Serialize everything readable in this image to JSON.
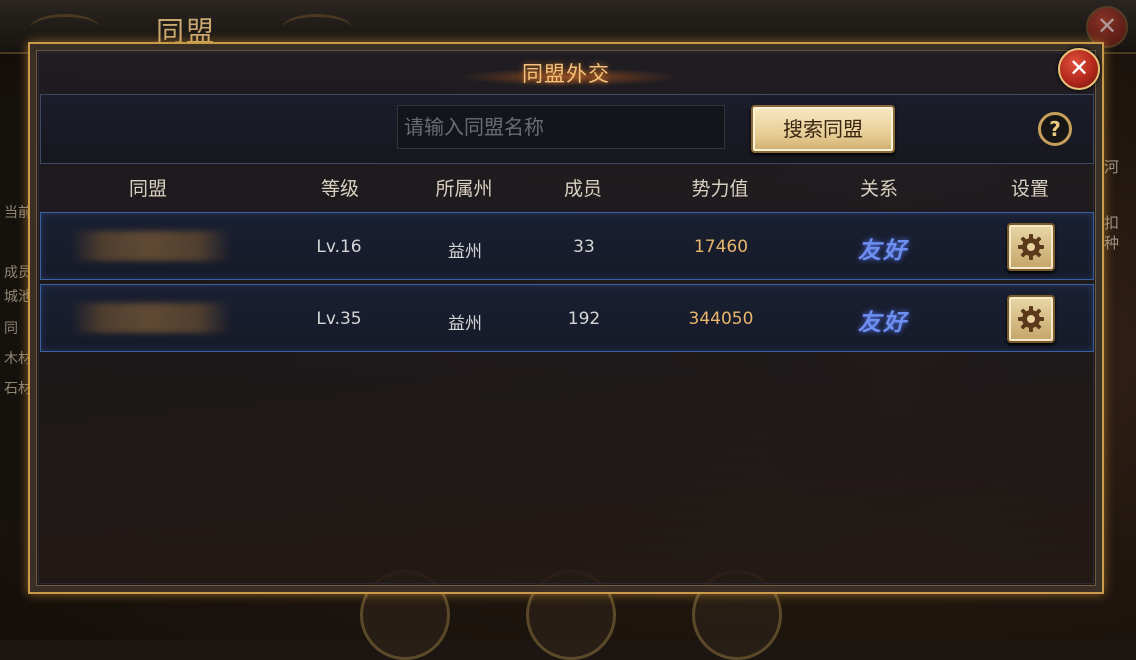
{
  "background": {
    "screen_title": "同盟",
    "left_labels": [
      "当前",
      "成员",
      "城池",
      "同",
      "木材",
      "石材"
    ],
    "right_labels": [
      "河",
      "扣",
      "种"
    ]
  },
  "dialog": {
    "title": "同盟外交",
    "close_symbol": "✕"
  },
  "search": {
    "placeholder": "请输入同盟名称",
    "value": "",
    "button_label": "搜索同盟",
    "help_symbol": "?"
  },
  "table": {
    "headers": [
      "同盟",
      "等级",
      "所属州",
      "成员",
      "势力值",
      "关系",
      "设置"
    ],
    "rows": [
      {
        "name": "",
        "level": "Lv.16",
        "state": "益州",
        "members": "33",
        "power": "17460",
        "relation": "友好"
      },
      {
        "name": "",
        "level": "Lv.35",
        "state": "益州",
        "members": "192",
        "power": "344050",
        "relation": "友好"
      }
    ]
  },
  "colors": {
    "accent_gold": "#c99a4a",
    "relation_blue": "#6f8ff0",
    "power_orange": "#e8b56c",
    "close_red": "#b3281c"
  },
  "icons": {
    "settings": "gear-icon",
    "close": "close-icon",
    "help": "question-icon"
  }
}
